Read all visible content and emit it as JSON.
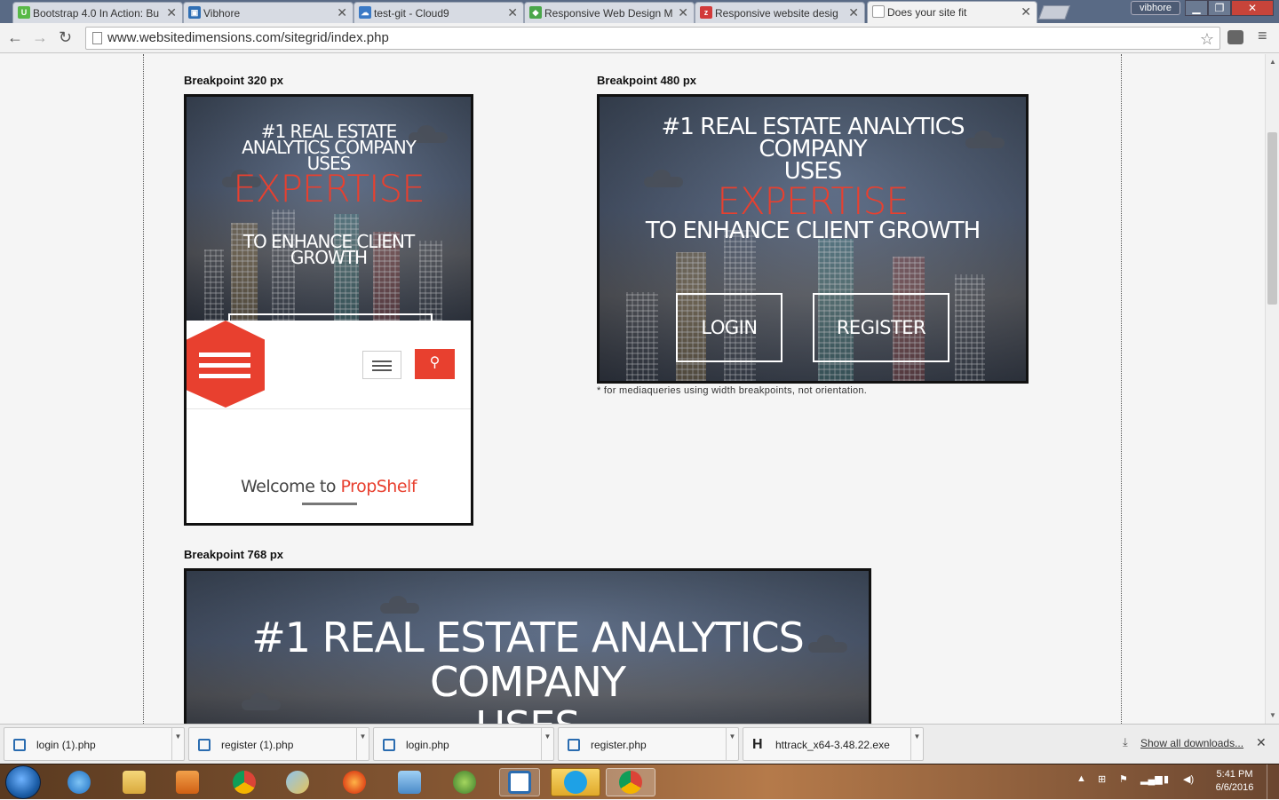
{
  "browser": {
    "tabs": [
      {
        "title": "Bootstrap 4.0 In Action: Bu",
        "favicon": "udemy-icon",
        "color": "#58b947",
        "active": false
      },
      {
        "title": "Vibhore",
        "favicon": "photo-icon",
        "color": "#2f6fb5",
        "active": false
      },
      {
        "title": "test-git - Cloud9",
        "favicon": "cloud9-icon",
        "color": "#3b7ac6",
        "active": false
      },
      {
        "title": "Responsive Web Design M",
        "favicon": "codeschool-icon",
        "color": "#4aa64a",
        "active": false
      },
      {
        "title": "Responsive website desig",
        "favicon": "zoho-icon",
        "color": "#d23a3a",
        "active": false
      },
      {
        "title": "Does your site fit",
        "favicon": "page-icon",
        "color": "#ffffff",
        "active": true
      }
    ],
    "profile_name": "vibhore",
    "url": "www.websitedimensions.com/sitegrid/index.php"
  },
  "page": {
    "breakpoints": {
      "bp320_label": "Breakpoint 320 px",
      "bp480_label": "Breakpoint 480 px",
      "bp768_label": "Breakpoint 768 px"
    },
    "note": "* for mediaqueries using width breakpoints, not orientation.",
    "hero": {
      "line1": "#1 REAL ESTATE ANALYTICS COMPANY",
      "line1_a": "#1 REAL ESTATE",
      "line1_b": "ANALYTICS COMPANY",
      "line1_480_a": "#1 REAL ESTATE ANALYTICS",
      "line1_480_b": "COMPANY",
      "uses": "USES",
      "expertise": "EXPERTISE",
      "tagline_a": "TO ENHANCE CLIENT",
      "tagline_b": "GROWTH",
      "tagline": "TO ENHANCE CLIENT GROWTH",
      "login": "LOGIN",
      "register": "REGISTER",
      "accent_color": "#e8402f"
    },
    "welcome_prefix": "Welcome to ",
    "welcome_brand": "PropShelf"
  },
  "downloads": {
    "items": [
      {
        "name": "login (1).php"
      },
      {
        "name": "register (1).php"
      },
      {
        "name": "login.php"
      },
      {
        "name": "register.php"
      },
      {
        "name": "httrack_x64-3.48.22.exe"
      }
    ],
    "show_all": "Show all downloads..."
  },
  "taskbar": {
    "time": "5:41 PM",
    "date": "6/6/2016"
  }
}
